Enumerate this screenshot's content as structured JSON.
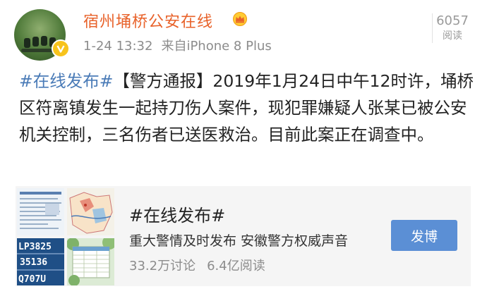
{
  "post": {
    "user_name": "宿州埇桥公安在线",
    "time": "1-24 13:32",
    "source": "来自iPhone 8 Plus",
    "read_count": "6057",
    "read_label": "阅读",
    "hashtag": "#在线发布#",
    "body": "【警方通报】2019年1月24日中午12时许，埇桥区符离镇发生一起持刀伤人案件，现犯罪嫌疑人张某已被公安机关控制，三名伤者已送医救治。目前此案正在调查中。"
  },
  "topic_card": {
    "title": "#在线发布#",
    "description": "重大警情及时发布 安徽警方权威声音",
    "discussions": "33.2万讨论",
    "reads": "6.4亿阅读",
    "button_label": "发博",
    "thumb_plate_text": "LP3825 35136 Q707U"
  },
  "icons": {
    "avatar": "motorcycle-police-avatar",
    "verified": "verified-v-badge-icon",
    "member": "member-crown-icon"
  },
  "colors": {
    "username": "#e8622a",
    "link": "#4a7bb7",
    "button": "#5b8fd5",
    "verified_badge": "#f7c31c"
  }
}
